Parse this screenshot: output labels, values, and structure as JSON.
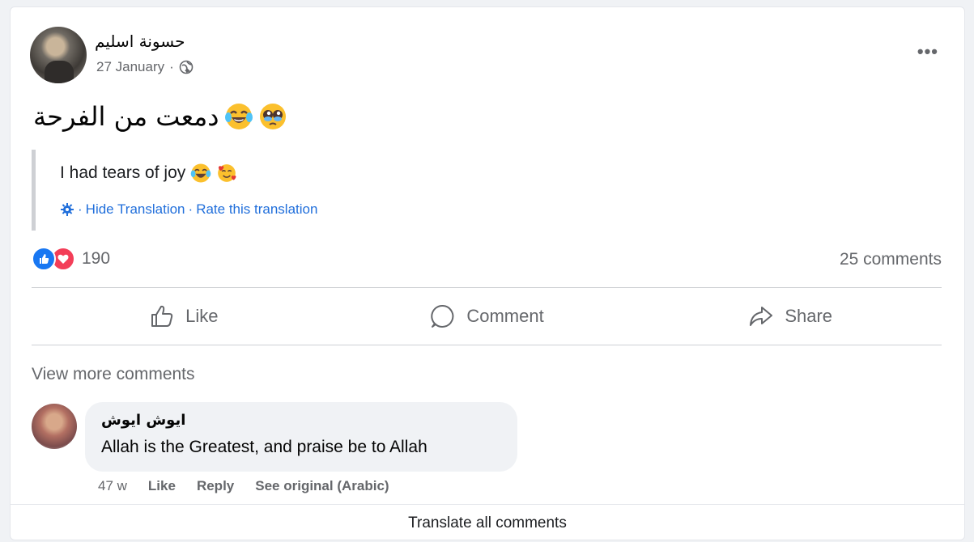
{
  "post": {
    "author": "حسونة اسليم",
    "date": "27 January",
    "separator": "·",
    "privacy_icon": "globe-icon",
    "more_icon": "more-options-icon",
    "text": "دمعت من الفرحة",
    "text_emojis": [
      "pleading-face-emoji",
      "tears-of-joy-emoji"
    ],
    "translation": {
      "text": "I had tears of joy",
      "emojis": [
        "tears-of-joy-emoji",
        "smiling-face-with-hearts-emoji"
      ],
      "settings_icon": "gear-icon",
      "hide_label": "Hide Translation",
      "rate_label": "Rate this translation",
      "sep": "·"
    }
  },
  "stats": {
    "reaction_icons": [
      "like-reaction",
      "love-reaction"
    ],
    "reaction_count": "190",
    "comments_count": "25 comments"
  },
  "actions": {
    "like": "Like",
    "comment": "Comment",
    "share": "Share"
  },
  "comments": {
    "view_more": "View more comments",
    "items": [
      {
        "author": "ايوش ايوش",
        "text": "Allah is the Greatest, and praise be to Allah",
        "time": "47 w",
        "like": "Like",
        "reply": "Reply",
        "see_original": "See original (Arabic)"
      }
    ]
  },
  "footer": {
    "translate_all": "Translate all comments"
  },
  "colors": {
    "link_blue": "#216fdb",
    "like_blue": "#1877f2",
    "love_red": "#f33e58",
    "secondary_text": "#65676b"
  }
}
